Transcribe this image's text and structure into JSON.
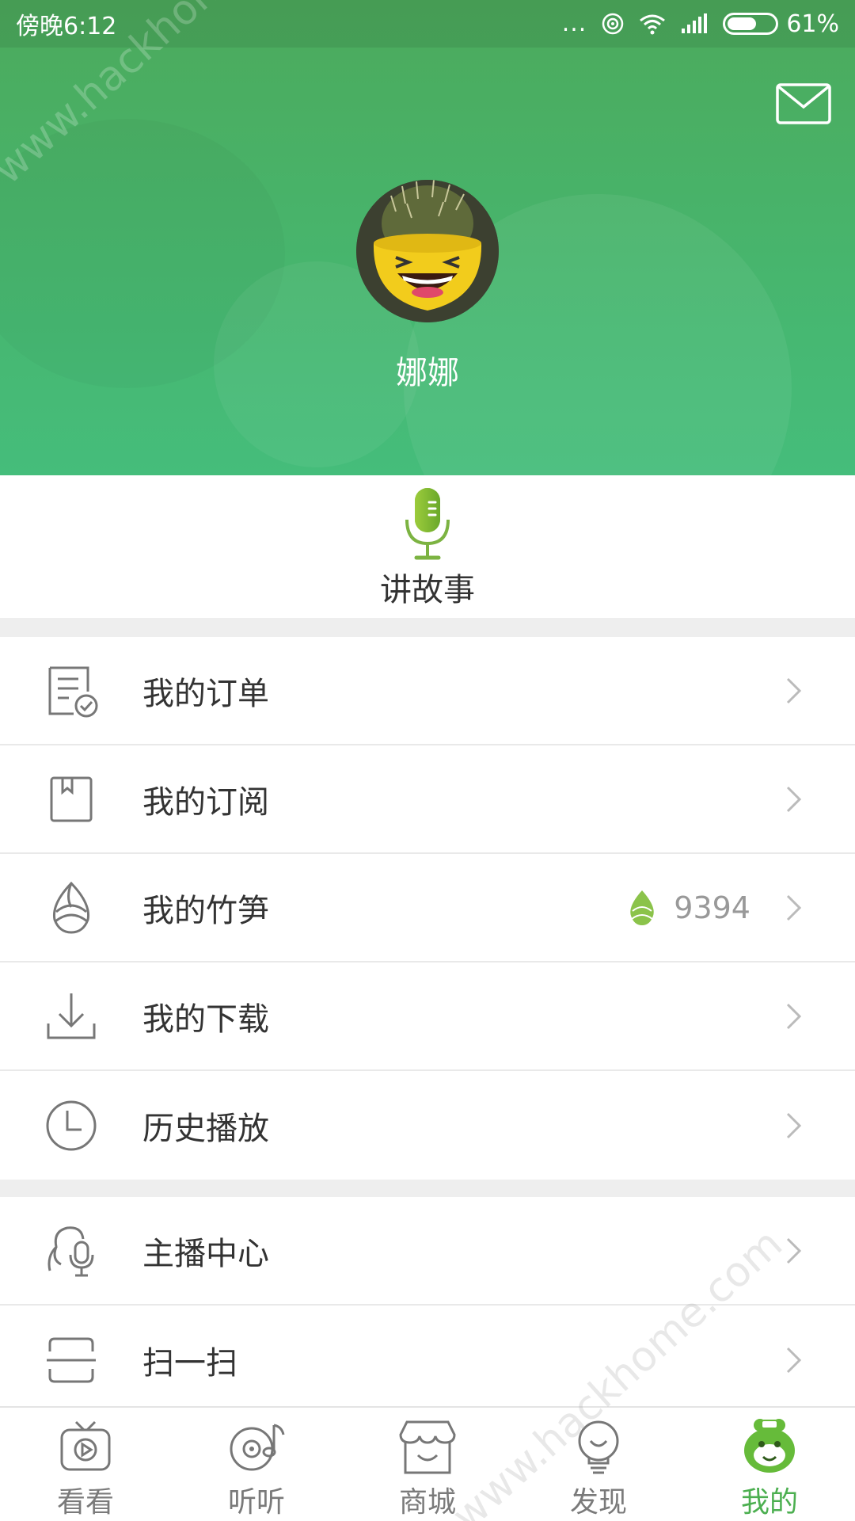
{
  "status_bar": {
    "time": "傍晚6:12",
    "dots": "...",
    "battery": "61%",
    "battery_level": 0.61
  },
  "header": {
    "username": "娜娜"
  },
  "storytelling": {
    "label": "讲故事"
  },
  "menu_group_1": [
    {
      "label": "我的订单"
    },
    {
      "label": "我的订阅"
    },
    {
      "label": "我的竹笋",
      "value": "9394"
    },
    {
      "label": "我的下载"
    },
    {
      "label": "历史播放"
    }
  ],
  "menu_group_2": [
    {
      "label": "主播中心"
    },
    {
      "label": "扫一扫"
    }
  ],
  "bottom_nav": [
    {
      "label": "看看"
    },
    {
      "label": "听听"
    },
    {
      "label": "商城"
    },
    {
      "label": "发现"
    },
    {
      "label": "我的"
    }
  ],
  "watermark": "www.hackhome.com",
  "colors": {
    "accent": "#4caf50",
    "header_top": "#4caa5c",
    "header_bottom": "#45bd7b",
    "text": "#333333",
    "muted": "#999999"
  }
}
